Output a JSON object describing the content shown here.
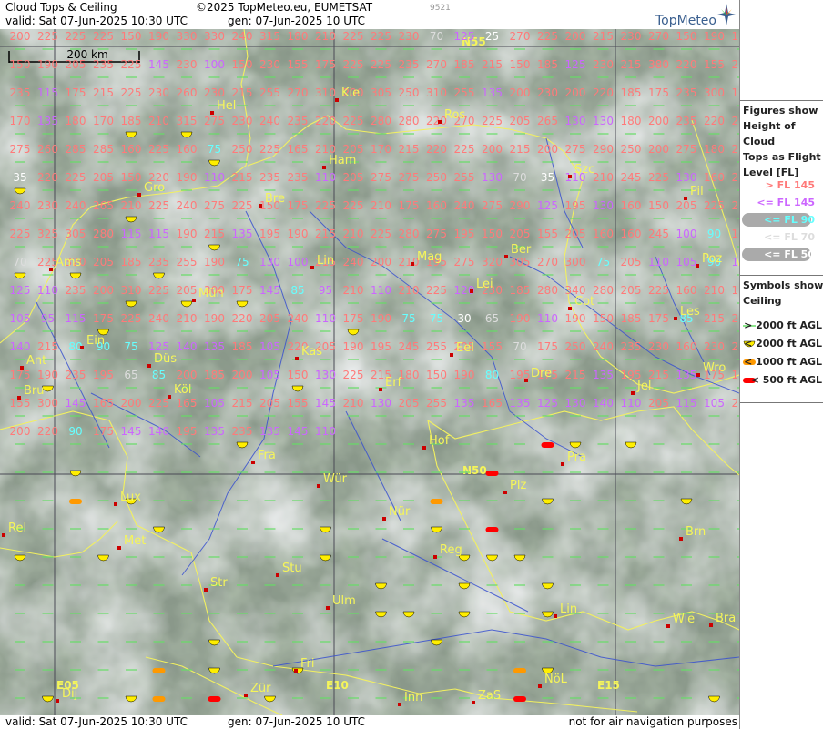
{
  "header": {
    "title": "Cloud Tops & Ceiling",
    "copyright": "©2025 TopMeteo.eu, EUMETSAT",
    "valid": "valid:  Sat  07-Jun-2025  10:30 UTC",
    "gen": "gen: 07-Jun-2025 10 UTC",
    "image_id": "9521",
    "logo": "TopMeteo"
  },
  "footer": {
    "valid": "valid:  Sat  07-Jun-2025  10:30 UTC",
    "gen": "gen: 07-Jun-2025 10 UTC",
    "note": "not for air navigation purposes"
  },
  "scale_label": "200 km",
  "legend": {
    "figures_title": [
      "Figures show",
      "Height of Cloud",
      "Tops as Flight",
      "Level  [FL]"
    ],
    "levels": [
      {
        "label": "> FL 145",
        "color": "#ff7a7a",
        "pill": false
      },
      {
        "label": "<= FL 145",
        "color": "#cc66ff",
        "pill": false
      },
      {
        "label": "<= FL 90",
        "color": "#66ffff",
        "pill": true
      },
      {
        "label": "<= FL 70",
        "color": "#dddddd",
        "pill": false
      },
      {
        "label": "<= FL 50",
        "color": "#ffffff",
        "pill": true
      }
    ],
    "symbols_title": [
      "Symbols show",
      "Ceiling"
    ],
    "symbols": [
      {
        "label": "> 2000 ft AGL",
        "color": "#66dd66",
        "type": "line"
      },
      {
        "label": "< 2000 ft AGL",
        "color": "#ffee00",
        "type": "half"
      },
      {
        "label": "< 1000 ft AGL",
        "color": "#ff9900",
        "type": "bar"
      },
      {
        "label": "< 500 ft AGL",
        "color": "#ff0000",
        "type": "bar"
      }
    ]
  },
  "grid_labels": [
    "N55",
    "N50",
    "E05",
    "E10",
    "E15"
  ],
  "cities": [
    "Kie",
    "Hel",
    "Ros",
    "Ham",
    "Szc",
    "Gro",
    "Bre",
    "Pil",
    "Ber",
    "Poz",
    "Ams",
    "Lin",
    "Mag",
    "Lei",
    "Mün",
    "Cot",
    "Les",
    "Ein",
    "Kas",
    "Eel",
    "Dre",
    "Wro",
    "Ant",
    "Düs",
    "Erf",
    "Bru",
    "Köl",
    "Jel",
    "Hof",
    "Fra",
    "Pra",
    "Wür",
    "Plz",
    "Lux",
    "Nür",
    "Rel",
    "Met",
    "Reg",
    "Brn",
    "Stu",
    "Str",
    "Ulm",
    "Lin",
    "Wie",
    "Bra",
    "Fri",
    "Inn",
    "ZaS",
    "NöL",
    "Zür",
    "Dij"
  ],
  "flight_levels": [
    "200",
    "225",
    "225",
    "225",
    "150",
    "190",
    "330",
    "330",
    "240",
    "315",
    "180",
    "210",
    "225",
    "225",
    "230",
    "70",
    "125",
    "25",
    "270",
    "225",
    "200",
    "215",
    "230",
    "270",
    "150",
    "190",
    "190",
    "150",
    "190",
    "205",
    "235",
    "225",
    "145",
    "230",
    "100",
    "150",
    "230",
    "155",
    "175",
    "225",
    "225",
    "235",
    "270",
    "185",
    "215",
    "150",
    "185",
    "125",
    "230",
    "215",
    "380",
    "220",
    "155",
    "220",
    "235",
    "115",
    "175",
    "215",
    "225",
    "230",
    "260",
    "230",
    "215",
    "255",
    "270",
    "310",
    "200",
    "305",
    "250",
    "310",
    "255",
    "135",
    "200",
    "230",
    "200",
    "220",
    "185",
    "175",
    "235",
    "300",
    "175",
    "170",
    "135",
    "180",
    "170",
    "185",
    "210",
    "315",
    "275",
    "230",
    "240",
    "235",
    "220",
    "225",
    "280",
    "280",
    "220",
    "270",
    "225",
    "205",
    "265",
    "130",
    "130",
    "180",
    "200",
    "235",
    "220",
    "290",
    "275",
    "260",
    "285",
    "285",
    "160",
    "225",
    "160",
    "75",
    "250",
    "225",
    "165",
    "210",
    "205",
    "170",
    "215",
    "220",
    "225",
    "200",
    "215",
    "200",
    "275",
    "290",
    "250",
    "200",
    "275",
    "180",
    "225",
    "35",
    "220",
    "225",
    "205",
    "150",
    "220",
    "190",
    "110",
    "215",
    "235",
    "235",
    "110",
    "205",
    "275",
    "275",
    "250",
    "255",
    "130",
    "70",
    "35",
    "110",
    "210",
    "245",
    "225",
    "130",
    "160",
    "215",
    "240",
    "230",
    "240",
    "265",
    "210",
    "225",
    "240",
    "275",
    "225",
    "150",
    "175",
    "225",
    "225",
    "210",
    "175",
    "160",
    "240",
    "275",
    "290",
    "125",
    "195",
    "130",
    "160",
    "150",
    "205",
    "225",
    "235",
    "225",
    "325",
    "305",
    "280",
    "115",
    "115",
    "190",
    "215",
    "135",
    "195",
    "190",
    "215",
    "210",
    "225",
    "280",
    "275",
    "195",
    "150",
    "205",
    "155",
    "205",
    "160",
    "160",
    "245",
    "100",
    "90",
    "175",
    "70",
    "225",
    "320",
    "205",
    "185",
    "235",
    "255",
    "190",
    "75",
    "130",
    "100",
    "215",
    "240",
    "200",
    "210",
    "195",
    "275",
    "320",
    "305",
    "270",
    "300",
    "75",
    "205",
    "110",
    "105",
    "90",
    "115",
    "125",
    "110",
    "235",
    "200",
    "310",
    "225",
    "205",
    "300",
    "175",
    "145",
    "85",
    "95",
    "210",
    "110",
    "210",
    "225",
    "120",
    "230",
    "185",
    "280",
    "340",
    "280",
    "205",
    "225",
    "160",
    "210",
    "175",
    "105",
    "95",
    "115",
    "175",
    "225",
    "240",
    "210",
    "190",
    "220",
    "205",
    "240",
    "110",
    "175",
    "190",
    "75",
    "75",
    "30",
    "65",
    "190",
    "110",
    "190",
    "150",
    "185",
    "175",
    "85",
    "215",
    "225",
    "140",
    "215",
    "80",
    "90",
    "75",
    "125",
    "140",
    "135",
    "185",
    "105",
    "220",
    "205",
    "190",
    "195",
    "245",
    "255",
    "205",
    "155",
    "70",
    "175",
    "250",
    "240",
    "235",
    "230",
    "160",
    "230",
    "215",
    "175",
    "190",
    "235",
    "195",
    "65",
    "85",
    "200",
    "185",
    "200",
    "105",
    "150",
    "130",
    "225",
    "215",
    "180",
    "150",
    "190",
    "80",
    "195",
    "175",
    "215",
    "135",
    "195",
    "215",
    "135",
    "175",
    "170",
    "155",
    "300",
    "145",
    "165",
    "200",
    "225",
    "165",
    "105",
    "215",
    "205",
    "155",
    "145",
    "210",
    "130",
    "205",
    "255",
    "135",
    "165",
    "135",
    "125",
    "130",
    "140",
    "110",
    "205",
    "115",
    "105",
    "215",
    "200",
    "220",
    "90",
    "175",
    "145",
    "140",
    "195",
    "135",
    "235",
    "135",
    "145",
    "110"
  ]
}
